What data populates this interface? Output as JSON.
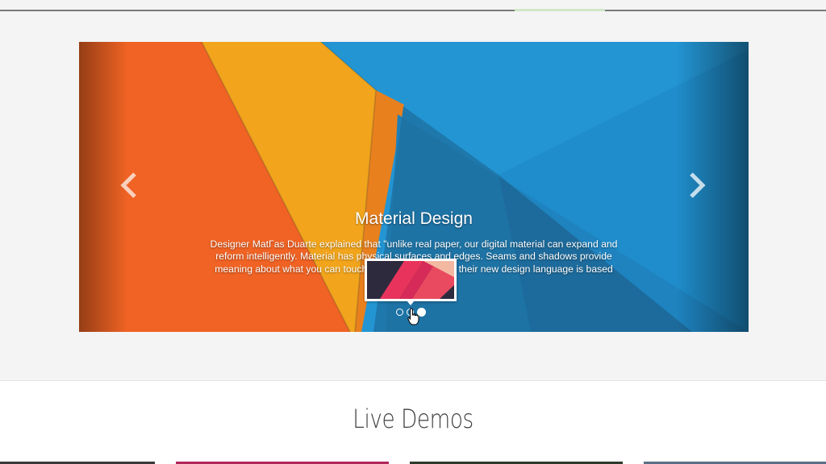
{
  "slider": {
    "caption_title": "Material Design",
    "caption_text": "Designer MatΓas Duarte explained that \"unlike real paper, our digital material can expand and reform intelligently. Material has physical surfaces and edges. Seams and shadows provide meaning about what you can touch.\" Google states that their new design language is based on paper and ink.",
    "prev_icon": "chevron-left-icon",
    "next_icon": "chevron-right-icon",
    "dots": [
      {
        "label": "slide-1",
        "active": false
      },
      {
        "label": "slide-2",
        "active": false
      },
      {
        "label": "slide-3",
        "active": true
      }
    ]
  },
  "demos": {
    "title": "Live Demos"
  },
  "colors": {
    "orange": "#f06324",
    "yellow": "#f2a51c",
    "blue": "#2395d3",
    "dark_blue": "#1f5f86"
  }
}
